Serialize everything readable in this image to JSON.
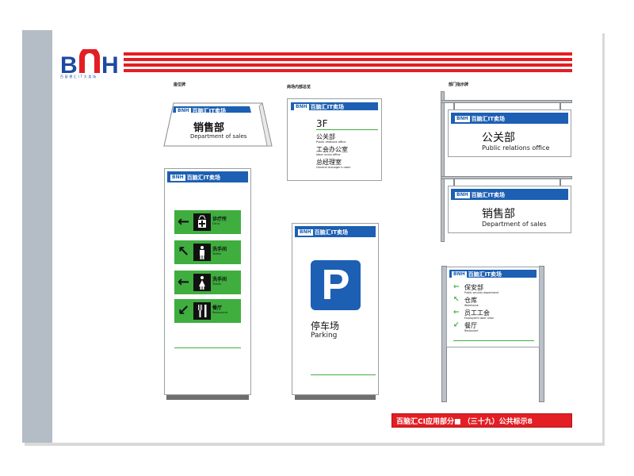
{
  "brand": {
    "logo_letters": "BNH",
    "logo_subtitle": "百 丽 德 汇 I T 大 卖 场",
    "badge": "BNH",
    "name": "百脑汇IT卖场"
  },
  "sections": {
    "desk_sign": "座位牌",
    "store_directory": "商场内部总览",
    "department_sign": "部门指示牌"
  },
  "desk_sign": {
    "cn": "销售部",
    "en": "Department of sales"
  },
  "directory_sign": {
    "floor": "3F",
    "items": [
      {
        "cn": "公关部",
        "en": "Public relations office"
      },
      {
        "cn": "工会办公室",
        "en": "labor union office"
      },
      {
        "cn": "总经理室",
        "en": "General manager's room"
      }
    ]
  },
  "hanging_signs": [
    {
      "cn": "公关部",
      "en": "Public relations office"
    },
    {
      "cn": "销售部",
      "en": "Department of sales"
    }
  ],
  "tall_sign": {
    "items": [
      {
        "arrow": "←",
        "icon": "clinic-icon",
        "cn": "诊疗所",
        "en": "Clinic"
      },
      {
        "arrow": "↖",
        "icon": "male-toilet-icon",
        "cn": "洗手间",
        "en": "Toilets"
      },
      {
        "arrow": "←",
        "icon": "female-toilet-icon",
        "cn": "洗手间",
        "en": "Toilets"
      },
      {
        "arrow": "↙",
        "icon": "restaurant-icon",
        "cn": "餐厅",
        "en": "Restaurant"
      }
    ]
  },
  "parking_sign": {
    "symbol": "P",
    "cn": "停车场",
    "en": "Parking"
  },
  "post_sign": {
    "items": [
      {
        "arrow": "←",
        "cn": "保安部",
        "en": "Public security department"
      },
      {
        "arrow": "↖",
        "cn": "仓库",
        "en": "Warehouse"
      },
      {
        "arrow": "←",
        "cn": "员工工会",
        "en": "Employee's labor union"
      },
      {
        "arrow": "↙",
        "cn": "餐厅",
        "en": "Restaurant"
      }
    ]
  },
  "footer": "百脑汇CI应用部分■ （三十九）公共标示8",
  "colors": {
    "brand_blue": "#1c5fb3",
    "accent_red": "#e31e24",
    "sign_green": "#3fae3f"
  }
}
